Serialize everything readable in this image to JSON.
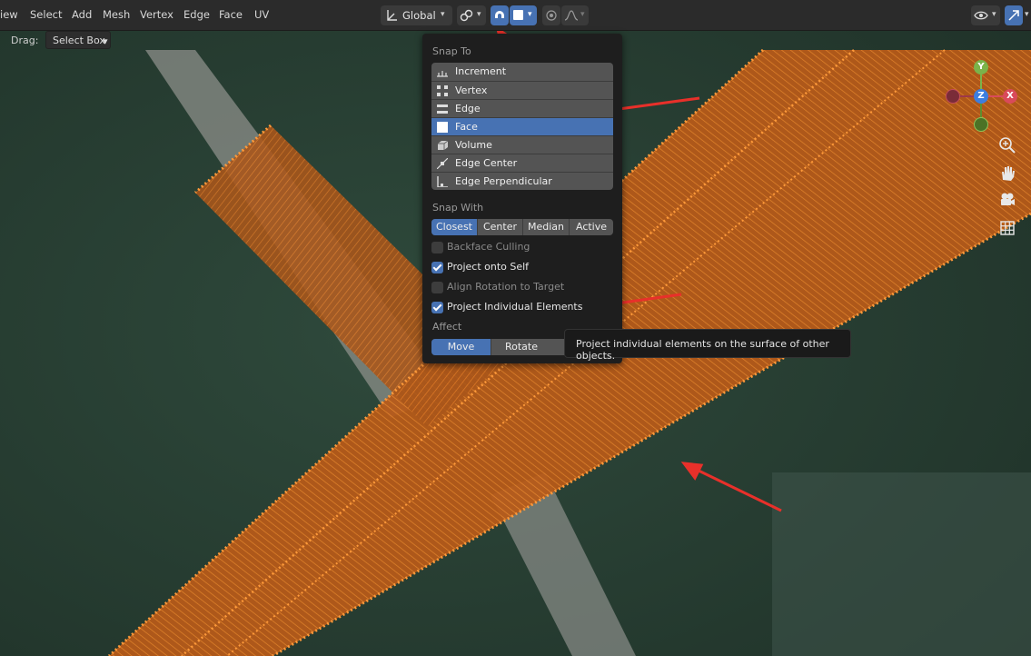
{
  "menu": {
    "items": [
      "iew",
      "Select",
      "Add",
      "Mesh",
      "Vertex",
      "Edge",
      "Face",
      "UV"
    ]
  },
  "toolbar": {
    "orientation_label": "Global"
  },
  "drag": {
    "label": "Drag:",
    "value": "Select Box"
  },
  "snap_popup": {
    "snap_to_title": "Snap To",
    "snap_to_items": [
      {
        "label": "Increment",
        "icon": "increment-icon",
        "selected": false
      },
      {
        "label": "Vertex",
        "icon": "vertex-icon",
        "selected": false
      },
      {
        "label": "Edge",
        "icon": "edge-icon",
        "selected": false
      },
      {
        "label": "Face",
        "icon": "face-icon",
        "selected": true
      },
      {
        "label": "Volume",
        "icon": "volume-icon",
        "selected": false
      },
      {
        "label": "Edge Center",
        "icon": "edge-center-icon",
        "selected": false
      },
      {
        "label": "Edge Perpendicular",
        "icon": "edge-perpendicular-icon",
        "selected": false
      }
    ],
    "snap_with_title": "Snap With",
    "snap_with_options": [
      "Closest",
      "Center",
      "Median",
      "Active"
    ],
    "snap_with_selected": "Closest",
    "options": [
      {
        "label": "Backface Culling",
        "checked": false,
        "enabled": false
      },
      {
        "label": "Project onto Self",
        "checked": true,
        "enabled": true
      },
      {
        "label": "Align Rotation to Target",
        "checked": false,
        "enabled": false
      },
      {
        "label": "Project Individual Elements",
        "checked": true,
        "enabled": true
      }
    ],
    "affect_title": "Affect",
    "affect_options": [
      "Move",
      "Rotate"
    ],
    "affect_selected": "Move"
  },
  "tooltip": {
    "text": "Project individual elements on the surface of other objects."
  },
  "gizmo": {
    "y_label": "Y",
    "z_label": "Z",
    "x_label": "X"
  },
  "colors": {
    "accent": "#4772b3",
    "mesh_orange": "#e07a22",
    "annotation_red": "#e8302a"
  }
}
